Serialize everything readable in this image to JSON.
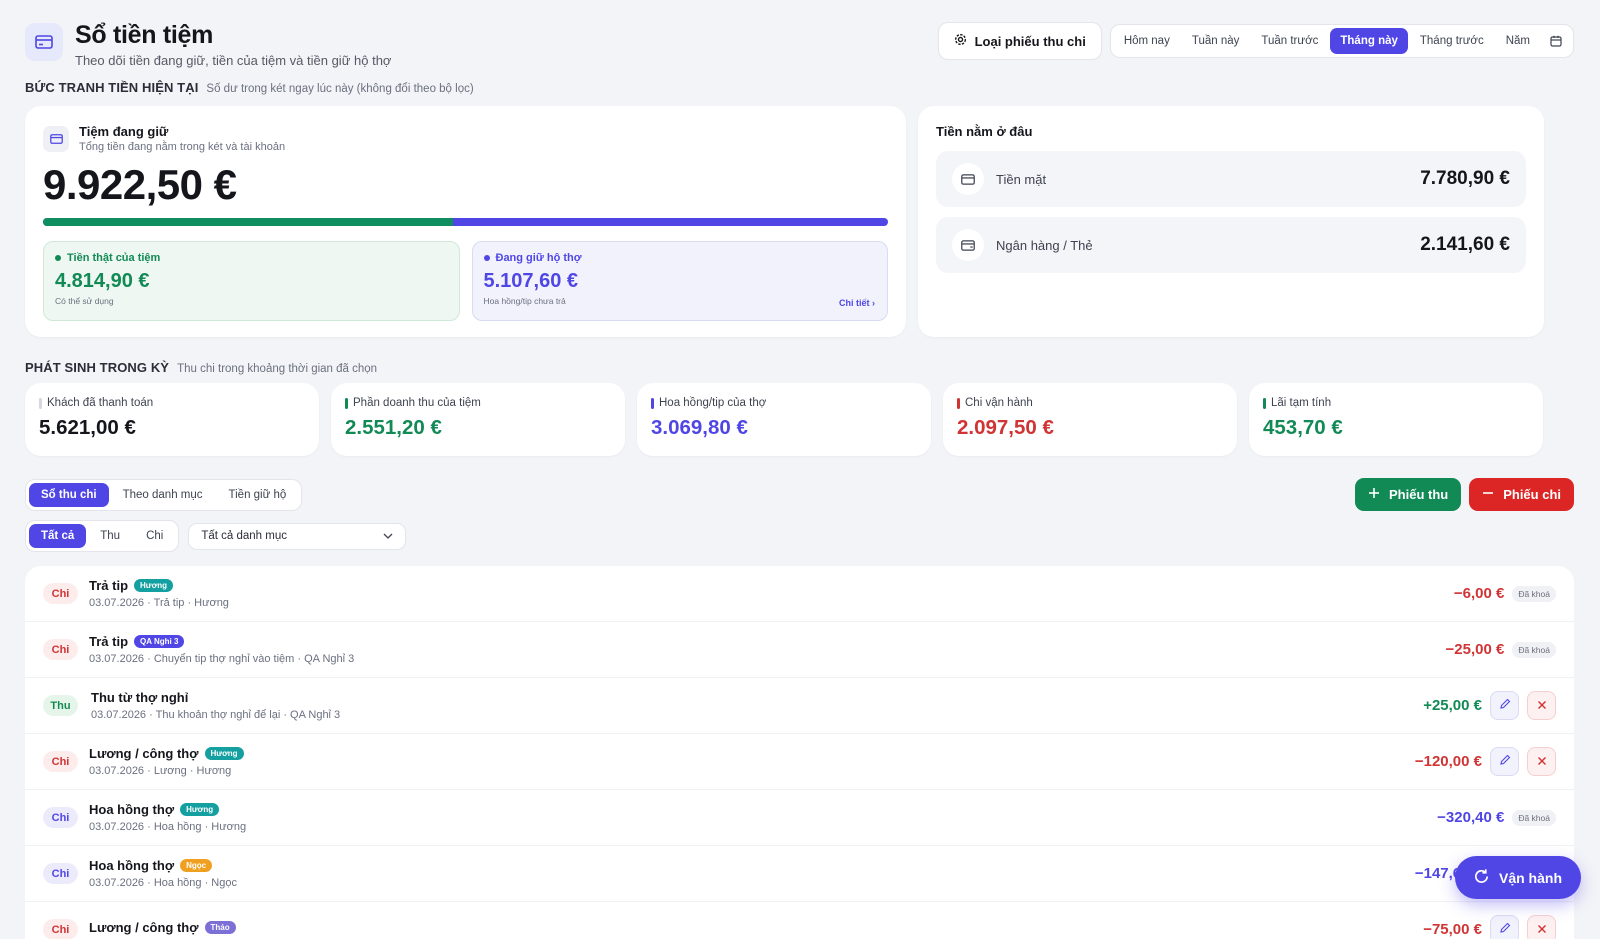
{
  "header": {
    "title": "Sổ tiền tiệm",
    "subtitle": "Theo dõi tiền đang giữ, tiền của tiệm và tiền giữ hộ thợ",
    "type_button": "Loại phiếu thu chi",
    "periods": [
      "Hôm nay",
      "Tuần này",
      "Tuần trước",
      "Tháng này",
      "Tháng trước",
      "Năm"
    ],
    "active_period": "Tháng này"
  },
  "current": {
    "section_title": "BỨC TRANH TIỀN HIỆN TẠI",
    "section_note": "Số dư trong két ngay lúc này (không đổi theo bộ lọc)",
    "holding_title": "Tiệm đang giữ",
    "holding_sub": "Tổng tiền đang nằm trong két và tài khoản",
    "holding_total": "9.922,50 €",
    "own_share_fraction": 0.485,
    "own": {
      "label": "Tiền thật của tiệm",
      "amount": "4.814,90 €",
      "sub": "Có thể sử dụng"
    },
    "held": {
      "label": "Đang giữ hộ thợ",
      "amount": "5.107,60 €",
      "sub": "Hoa hồng/tip chưa trả",
      "link": "Chi tiết"
    },
    "where_title": "Tiền nằm ở đâu",
    "where": [
      {
        "label": "Tiền mặt",
        "value": "7.780,90 €"
      },
      {
        "label": "Ngân hàng / Thẻ",
        "value": "2.141,60 €"
      }
    ]
  },
  "period": {
    "section_title": "PHÁT SINH TRONG KỲ",
    "section_note": "Thu chi trong khoảng thời gian đã chọn",
    "stats": [
      {
        "label": "Khách đã thanh toán",
        "value": "5.621,00 €",
        "color": "#15161c",
        "bar": "#d6d8de"
      },
      {
        "label": "Phần doanh thu của tiệm",
        "value": "2.551,20 €",
        "color": "#118a55",
        "bar": "#118a55"
      },
      {
        "label": "Hoa hồng/tip của thợ",
        "value": "3.069,80 €",
        "color": "#4f46e5",
        "bar": "#4f46e5"
      },
      {
        "label": "Chi vận hành",
        "value": "2.097,50 €",
        "color": "#d03434",
        "bar": "#d03434"
      },
      {
        "label": "Lãi tạm tính",
        "value": "453,70 €",
        "color": "#118a55",
        "bar": "#118a55"
      }
    ]
  },
  "tabs": {
    "items": [
      "Sổ thu chi",
      "Theo danh mục",
      "Tiền giữ hộ"
    ],
    "active": "Sổ thu chi"
  },
  "actions": {
    "income": "Phiếu thu",
    "expense": "Phiếu chi"
  },
  "filters": {
    "kinds": [
      "Tất cả",
      "Thu",
      "Chi"
    ],
    "active": "Tất cả",
    "category": "Tất cả danh mục"
  },
  "ledger": [
    {
      "kind": "Chi",
      "kindStyle": "chi",
      "title": "Trả tip",
      "tag": "Hương",
      "tagColor": "#14a0a0",
      "sub": "03.07.2026 · Trả tip · Hương",
      "amount": "−6,00 €",
      "amountColor": "#d03434",
      "locked": "Đã khoá"
    },
    {
      "kind": "Chi",
      "kindStyle": "chi",
      "title": "Trả tip",
      "tag": "QA Nghỉ 3",
      "tagColor": "#4f46e5",
      "sub": "03.07.2026 · Chuyển tip thợ nghỉ vào tiệm · QA Nghỉ 3",
      "amount": "−25,00 €",
      "amountColor": "#d03434",
      "locked": "Đã khoá"
    },
    {
      "kind": "Thu",
      "kindStyle": "thu",
      "title": "Thu từ thợ nghỉ",
      "tag": "",
      "tagColor": "",
      "sub": "03.07.2026 · Thu khoản thợ nghỉ để lại · QA Nghỉ 3",
      "amount": "+25,00 €",
      "amountColor": "#118a55",
      "locked": ""
    },
    {
      "kind": "Chi",
      "kindStyle": "chi",
      "title": "Lương / công thợ",
      "tag": "Hương",
      "tagColor": "#14a0a0",
      "sub": "03.07.2026 · Lương · Hương",
      "amount": "−120,00 €",
      "amountColor": "#d03434",
      "locked": ""
    },
    {
      "kind": "Chi",
      "kindStyle": "chi violet",
      "title": "Hoa hồng thợ",
      "tag": "Hương",
      "tagColor": "#14a0a0",
      "sub": "03.07.2026 · Hoa hồng · Hương",
      "amount": "−320,40 €",
      "amountColor": "#4f46e5",
      "locked": "Đã khoá"
    },
    {
      "kind": "Chi",
      "kindStyle": "chi violet",
      "title": "Hoa hồng thợ",
      "tag": "Ngọc",
      "tagColor": "#f0a020",
      "sub": "03.07.2026 · Hoa hồng · Ngọc",
      "amount": "−147,60 €",
      "amountColor": "#4f46e5",
      "locked": ""
    },
    {
      "kind": "Chi",
      "kindStyle": "chi",
      "title": "Lương / công thợ",
      "tag": "Thảo",
      "tagColor": "#7c6fd6",
      "sub": "",
      "amount": "−75,00 €",
      "amountColor": "#d03434",
      "locked": ""
    }
  ],
  "fab": {
    "label": "Vận hành"
  }
}
